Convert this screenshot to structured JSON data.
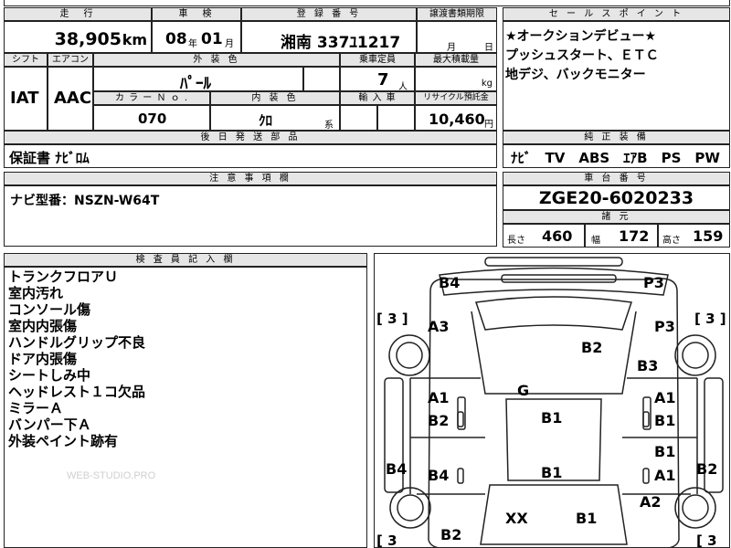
{
  "top_row": {
    "mileage_label": "走　行",
    "mileage_value": "38,905",
    "mileage_unit": "km",
    "inspection_label": "車　検",
    "inspection_year": "08",
    "inspection_year_unit": "年",
    "inspection_month": "01",
    "inspection_month_unit": "月",
    "registration_label": "登 録 番 号",
    "registration_value": "湘南 337ﾕ1217",
    "transfer_label": "譲渡書類期限",
    "transfer_month_unit": "月",
    "transfer_day_unit": "日"
  },
  "second_row": {
    "shift_label": "シフト",
    "shift_value": "IAT",
    "ac_label": "エアコン",
    "ac_value": "AAC",
    "exterior_color_label": "外 装 色",
    "exterior_color_value": "ﾊﾟｰﾙ",
    "capacity_label": "乗車定員",
    "capacity_value": "7",
    "capacity_unit": "人",
    "max_load_label": "最大積載量",
    "max_load_unit": "kg",
    "color_no_label": "カ ラ ー Ｎ ｏ .",
    "color_no_value": "070",
    "interior_color_label": "内 装 色",
    "interior_color_value": "ｸﾛ",
    "interior_suffix": "系",
    "import_label": "輸 入 車",
    "recycle_label": "リサイクル預託金",
    "recycle_value": "10,460",
    "recycle_unit": "円"
  },
  "later_parts": {
    "label": "後 日 発 送 部 品",
    "value": "保証書 ﾅﾋﾞﾛﾑ"
  },
  "notes": {
    "label": "注 意 事 項 欄",
    "value": "ナビ型番：NSZN-W64T"
  },
  "sales_points": {
    "label": "セ ー ル ス ポ イ ン ト",
    "lines": [
      "★オークションデビュー★",
      "プッシュスタート、ＥＴＣ",
      "地デジ、バックモニター"
    ]
  },
  "equipment": {
    "label": "純 正 装 備",
    "value": "ﾅﾋﾞ　TV　ABS　ｴｱB　PS　PW"
  },
  "chassis": {
    "label": "車 台 番 号",
    "value": "ZGE20-6020233"
  },
  "specs": {
    "label": "諸 元",
    "length_label": "長さ",
    "length_value": "460",
    "width_label": "幅",
    "width_value": "172",
    "height_label": "高さ",
    "height_value": "159"
  },
  "inspector": {
    "label": "検 査 員 記 入 欄",
    "lines": [
      "トランクフロアＵ",
      "室内汚れ",
      "コンソール傷",
      "室内内張傷",
      "ハンドルグリップ不良",
      "ドア内張傷",
      "シートしみ中",
      "ヘッドレスト１コ欠品",
      "ミラーＡ",
      "バンパー下Ａ",
      "外装ペイント跡有"
    ]
  },
  "watermark": "WEB-STUDIO.PRO",
  "diagram": {
    "marks": [
      "B4",
      "P3",
      "A3",
      "P3",
      "B2",
      "B3",
      "G",
      "A1",
      "A1",
      "B2",
      "B1",
      "B1",
      "B1",
      "B4",
      "B4",
      "B1",
      "A1",
      "B2",
      "A2",
      "XX",
      "B1",
      "B2"
    ],
    "tire_counts": [
      "[ 3 ]",
      "[ 3 ]",
      "[ 3",
      "[ 3"
    ]
  }
}
